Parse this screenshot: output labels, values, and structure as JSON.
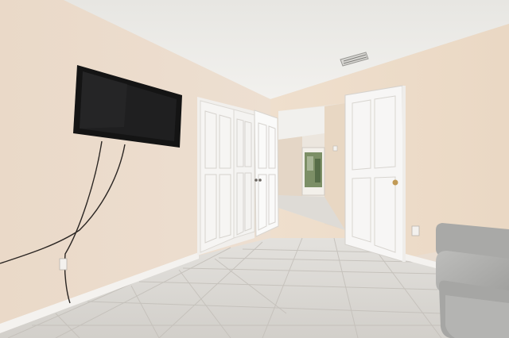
{
  "scene": {
    "description_visible_text": "",
    "colors": {
      "wall_left": "#eadbcc",
      "wall_right": "#eddcc9",
      "ceiling": "#ecebe7",
      "floor": "#d9d6d1",
      "floor_grout": "#c2beb8",
      "door": "#f4f3f2",
      "trim": "#f3f1ee",
      "tv": "#1a1a1a",
      "sofa": "#b3b3b1",
      "hallway_wall": "#e7d8c6",
      "doorway_glow": "#f2efe9",
      "outdoor_green": "#6e8a5a"
    }
  }
}
